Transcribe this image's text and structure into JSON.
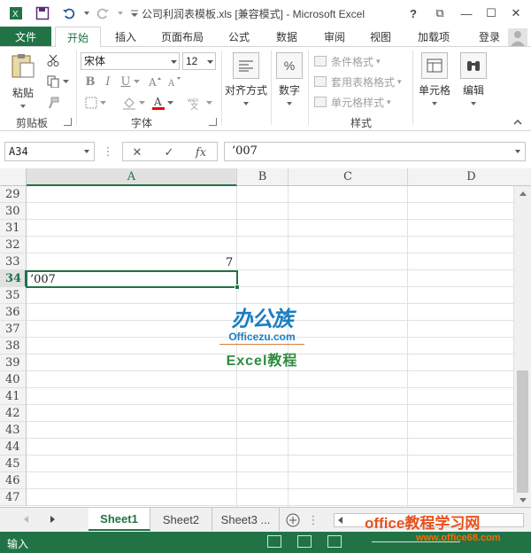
{
  "window": {
    "title": "公司利润表模板.xls  [兼容模式] - Microsoft Excel",
    "help": "?",
    "restore_ribbon": "⧉",
    "minimize": "—",
    "maximize": "☐",
    "close": "✕"
  },
  "ribbon_tabs": {
    "file": "文件",
    "home": "开始",
    "insert": "插入",
    "page_layout": "页面布局",
    "formulas": "公式",
    "data": "数据",
    "review": "审阅",
    "view": "视图",
    "addins": "加载项",
    "login": "登录"
  },
  "clipboard": {
    "paste": "粘贴",
    "label": "剪贴板"
  },
  "font": {
    "name": "宋体",
    "size": "12",
    "bold": "B",
    "italic": "I",
    "underline": "U",
    "label": "字体"
  },
  "alignment": {
    "label": "对齐方式"
  },
  "number": {
    "label": "数字",
    "symbol": "%"
  },
  "styles": {
    "conditional": "条件格式",
    "table_format": "套用表格格式",
    "cell_styles": "单元格样式",
    "label": "样式"
  },
  "cells": {
    "label": "单元格"
  },
  "editing": {
    "label": "编辑"
  },
  "formula_bar": {
    "name_box": "A34",
    "cancel": "✕",
    "confirm": "✓",
    "fx": "fx",
    "content": "’007"
  },
  "columns": [
    "A",
    "B",
    "C",
    "D"
  ],
  "rows": [
    "29",
    "30",
    "31",
    "32",
    "33",
    "34",
    "35",
    "36",
    "37",
    "38",
    "39",
    "40",
    "41",
    "42",
    "43",
    "44",
    "45",
    "46",
    "47"
  ],
  "cells_data": {
    "b33": "7",
    "a34": "’007"
  },
  "watermark": {
    "logo": "办公族",
    "site": "Officezu.com",
    "course": "Excel教程",
    "banner": "office教程学习网",
    "url": "www.office68.com"
  },
  "sheets": [
    "Sheet1",
    "Sheet2",
    "Sheet3 ..."
  ],
  "status": {
    "mode": "输入"
  }
}
